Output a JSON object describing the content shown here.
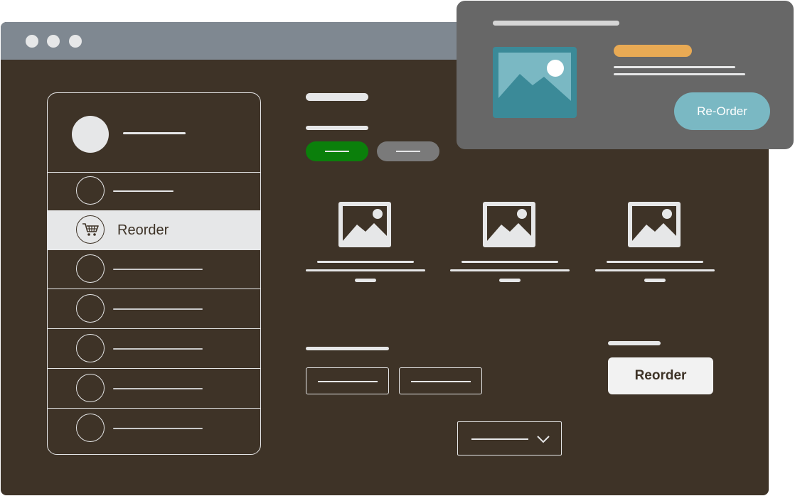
{
  "sidebar": {
    "items": [
      {
        "label": ""
      },
      {
        "label": "Reorder",
        "icon": "shopping-cart-icon"
      },
      {
        "label": ""
      },
      {
        "label": ""
      },
      {
        "label": ""
      },
      {
        "label": ""
      },
      {
        "label": ""
      }
    ]
  },
  "main": {
    "reorder_button_label": "Reorder"
  },
  "popup": {
    "button_label": "Re-Order"
  },
  "colors": {
    "background": "#3e3327",
    "titlebar": "#7f8891",
    "green_pill": "#0b7f0b",
    "grey_pill": "#7a7a7a",
    "popup_bg": "#676767",
    "popup_accent": "#e9aa54",
    "popup_button": "#7ab8c3",
    "thumb": "#3b8a98"
  }
}
